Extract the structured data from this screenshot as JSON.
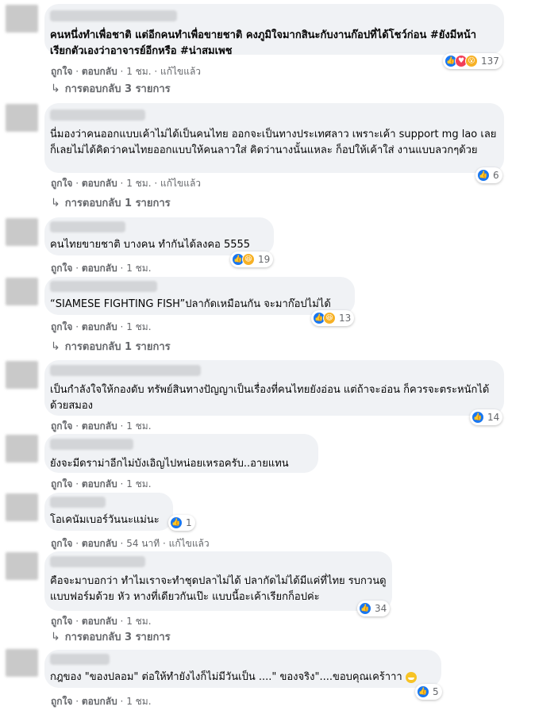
{
  "comments": [
    {
      "text": "คนหนึ่งทำเพื่อชาติ แต่อีกคนทำเพื่อขายชาติ คงภูมิใจมากสินะกับงานก๊อปที่ได้โชว์ก่อน #ยังมีหน้าเรียกตัวเองว่าอาจารย์อีกหรือ #น่าสมเพช",
      "reaction_icons": [
        "like-icon",
        "love-icon",
        "wow-icon"
      ],
      "reaction_count": "137",
      "like": "ถูกใจ",
      "reply": "ตอบกลับ",
      "time": "1 ชม.",
      "edited": "แก้ไขแล้ว",
      "replies": "การตอบกลับ 3 รายการ"
    },
    {
      "text": "นี่มองว่าคนออกแบบเค้าไม่ได้เป็นคนไทย ออกจะเป็นทางประเทศลาว เพราะเค้า support mg lao เลย ก็เลยไม่ได้คิดว่าคนไทยออกแบบให้คนลาวใส่ คิดว่านางนั้นแหละ ก็อปให้เค้าใส่ งานแบบลวกๆด้วย",
      "reaction_icons": [
        "like-icon"
      ],
      "reaction_count": "6",
      "like": "ถูกใจ",
      "reply": "ตอบกลับ",
      "time": "1 ชม.",
      "edited": "แก้ไขแล้ว",
      "replies": "การตอบกลับ 1 รายการ"
    },
    {
      "text": "คนไทยขายชาติ บางคน ทำกันได้ลงคอ 5555",
      "reaction_icons": [
        "like-icon",
        "haha-icon"
      ],
      "reaction_count": "19",
      "like": "ถูกใจ",
      "reply": "ตอบกลับ",
      "time": "1 ชม."
    },
    {
      "text": "“SIAMESE FIGHTING FISH”ปลากัดเหมือนกัน จะมาก๊อปไม่ได้",
      "reaction_icons": [
        "like-icon",
        "haha-icon"
      ],
      "reaction_count": "13",
      "like": "ถูกใจ",
      "reply": "ตอบกลับ",
      "time": "1 ชม.",
      "replies": "การตอบกลับ 1 รายการ"
    },
    {
      "text": "เป็นกำลังใจให้กองดับ ทรัพย์สินทางปัญญาเป็นเรื่องที่คนไทยยังอ่อน แต่ถ้าจะอ่อน ก็ควรจะตระหนักได้ด้วยสมอง",
      "reaction_icons": [
        "like-icon"
      ],
      "reaction_count": "14",
      "like": "ถูกใจ",
      "reply": "ตอบกลับ",
      "time": "1 ชม."
    },
    {
      "text": "ยังจะมีดราม่าอีกไม่บังเอิญไปหน่อยเหรอครับ..อายแทน",
      "like": "ถูกใจ",
      "reply": "ตอบกลับ",
      "time": "1 ชม."
    },
    {
      "text": "โอเคนัมเบอร์วันนะแม่นะ",
      "reaction_icons": [
        "like-icon"
      ],
      "reaction_count": "1",
      "like": "ถูกใจ",
      "reply": "ตอบกลับ",
      "time": "54 นาที",
      "edited": "แก้ไขแล้ว"
    },
    {
      "text": "คือจะมาบอกว่า ทำไมเราจะทำชุดปลาไม่ได้ ปลากัดไม่ได้มีแค่ที่ไทย รบกวนดูแบบฟอร์มด้วย หัว หางที่เดียวกันเป๊ะ แบบนี้อะเค้าเรียกก็อปค่ะ",
      "reaction_icons": [
        "like-icon"
      ],
      "reaction_count": "34",
      "like": "ถูกใจ",
      "reply": "ตอบกลับ",
      "time": "1 ชม.",
      "replies": "การตอบกลับ 3 รายการ"
    },
    {
      "text": "กฎของ \"ของปลอม\" ต่อให้ทำยังไงก็ไม่มีวันเป็น ....\" ของจริง\"....ขอบคุณเคร้าาา",
      "reaction_icons": [
        "like-icon"
      ],
      "reaction_count": "5",
      "like": "ถูกใจ",
      "reply": "ตอบกลับ",
      "time": "1 ชม."
    }
  ],
  "colors": {
    "bubble": "#f0f2f5",
    "meta": "#65676b",
    "like": "#1877f2",
    "love": "#f33e58",
    "wow": "#f7b125"
  }
}
